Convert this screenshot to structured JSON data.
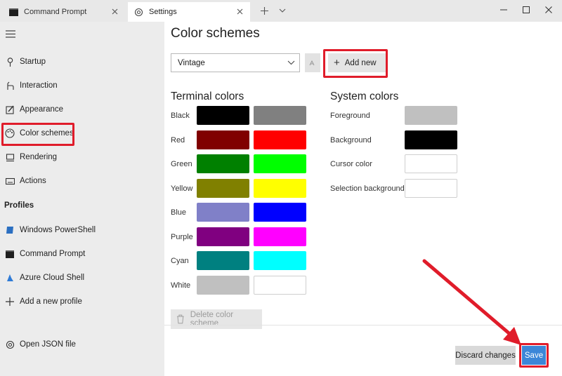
{
  "tabs": [
    {
      "label": "Command Prompt",
      "icon": "terminal-icon"
    },
    {
      "label": "Settings",
      "icon": "gear-icon"
    }
  ],
  "sidebar": {
    "items": [
      {
        "label": "Startup",
        "icon": "startup-icon"
      },
      {
        "label": "Interaction",
        "icon": "interaction-icon"
      },
      {
        "label": "Appearance",
        "icon": "appearance-icon"
      },
      {
        "label": "Color schemes",
        "icon": "palette-icon"
      },
      {
        "label": "Rendering",
        "icon": "rendering-icon"
      },
      {
        "label": "Actions",
        "icon": "keyboard-icon"
      }
    ],
    "profiles_header": "Profiles",
    "profiles": [
      {
        "label": "Windows PowerShell",
        "icon": "powershell-icon"
      },
      {
        "label": "Command Prompt",
        "icon": "terminal-icon"
      },
      {
        "label": "Azure Cloud Shell",
        "icon": "azure-icon"
      },
      {
        "label": "Add a new profile",
        "icon": "plus-icon"
      }
    ],
    "open_json": {
      "label": "Open JSON file",
      "icon": "json-gear-icon"
    }
  },
  "main": {
    "title": "Color schemes",
    "scheme_select": {
      "value": "Vintage"
    },
    "add_new_label": "Add new",
    "terminal_colors": {
      "title": "Terminal colors",
      "rows": [
        {
          "name": "Black",
          "normal": "#000000",
          "bright": "#808080"
        },
        {
          "name": "Red",
          "normal": "#800000",
          "bright": "#ff0000"
        },
        {
          "name": "Green",
          "normal": "#008000",
          "bright": "#00ff00"
        },
        {
          "name": "Yellow",
          "normal": "#808000",
          "bright": "#ffff00"
        },
        {
          "name": "Blue",
          "normal": "#8080c8",
          "bright": "#0000ff"
        },
        {
          "name": "Purple",
          "normal": "#800080",
          "bright": "#ff00ff"
        },
        {
          "name": "Cyan",
          "normal": "#008080",
          "bright": "#00ffff"
        },
        {
          "name": "White",
          "normal": "#c0c0c0",
          "bright": "#ffffff"
        }
      ]
    },
    "system_colors": {
      "title": "System colors",
      "rows": [
        {
          "name": "Foreground",
          "color": "#c0c0c0"
        },
        {
          "name": "Background",
          "color": "#000000"
        },
        {
          "name": "Cursor color",
          "color": "#ffffff"
        },
        {
          "name": "Selection background",
          "color": "#ffffff"
        }
      ]
    },
    "delete_label": "Delete color scheme",
    "discard_label": "Discard changes",
    "save_label": "Save"
  },
  "colors": {
    "highlight": "#e01c2a",
    "accent": "#3b86d8",
    "sidebar_bg": "#ececec",
    "titlebar_bg": "#e8e8e8"
  }
}
